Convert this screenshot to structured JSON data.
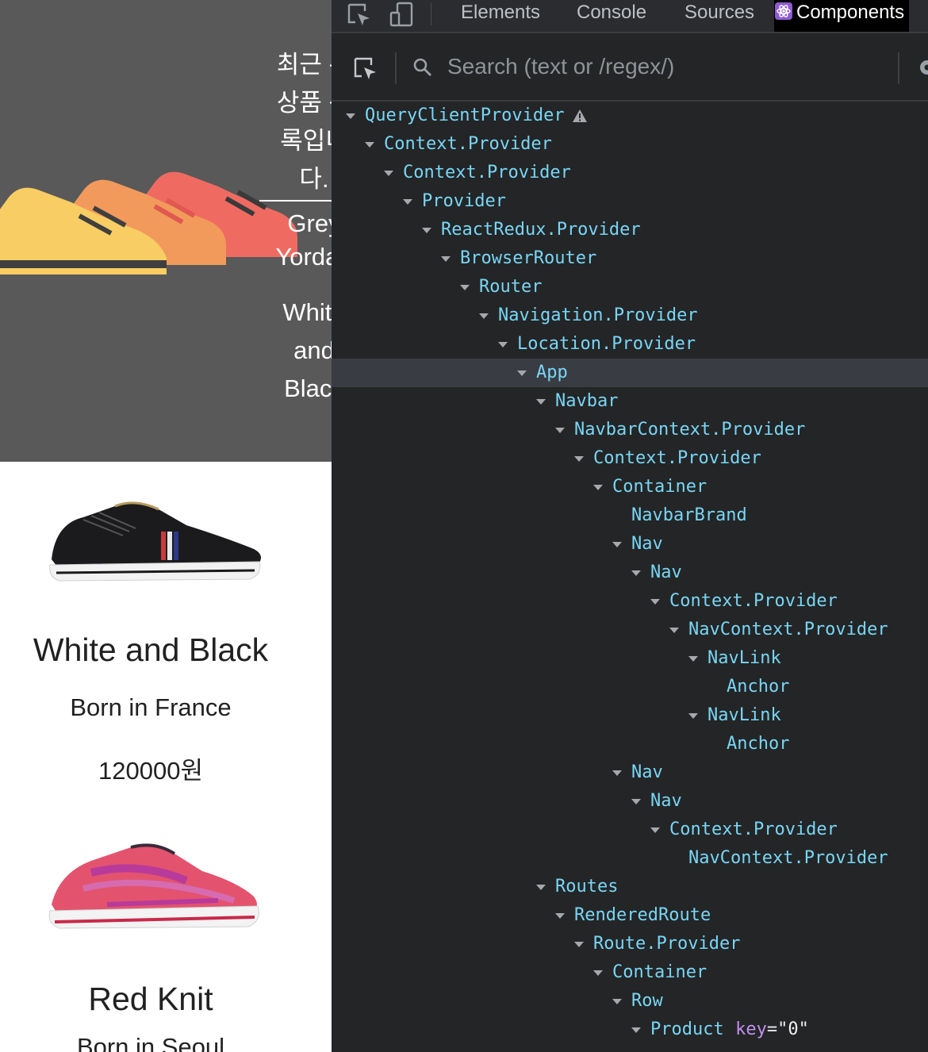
{
  "page": {
    "recent": {
      "heading_lines": [
        "최근 본",
        "상품 목",
        "록입니",
        "다."
      ],
      "items": [
        {
          "lines": [
            "Grey",
            "Yordan"
          ]
        },
        {
          "lines": [
            "White",
            "and",
            "Black"
          ]
        }
      ]
    },
    "products": [
      {
        "name": "White and Black",
        "origin": "Born in France",
        "price": "120000원"
      },
      {
        "name": "Red Knit",
        "origin": "Born in Seoul",
        "price": ""
      }
    ]
  },
  "devtools": {
    "tabs": [
      "Elements",
      "Console",
      "Sources",
      "Components"
    ],
    "active_tab": "Components",
    "search": {
      "placeholder": "Search (text or /regex/)"
    },
    "tree": [
      {
        "label": "QueryClientProvider",
        "expanded": true,
        "warning": true
      },
      {
        "label": "Context.Provider",
        "expanded": true
      },
      {
        "label": "Context.Provider",
        "expanded": true
      },
      {
        "label": "Provider",
        "expanded": true
      },
      {
        "label": "ReactRedux.Provider",
        "expanded": true
      },
      {
        "label": "BrowserRouter",
        "expanded": true
      },
      {
        "label": "Router",
        "expanded": true
      },
      {
        "label": "Navigation.Provider",
        "expanded": true
      },
      {
        "label": "Location.Provider",
        "expanded": true
      },
      {
        "label": "App",
        "expanded": true,
        "selected": true
      },
      {
        "label": "Navbar",
        "expanded": true
      },
      {
        "label": "NavbarContext.Provider",
        "expanded": true
      },
      {
        "label": "Context.Provider",
        "expanded": true
      },
      {
        "label": "Container",
        "expanded": true
      },
      {
        "label": "NavbarBrand",
        "expanded": false
      },
      {
        "label": "Nav",
        "expanded": true
      },
      {
        "label": "Nav",
        "expanded": true
      },
      {
        "label": "Context.Provider",
        "expanded": true
      },
      {
        "label": "NavContext.Provider",
        "expanded": true
      },
      {
        "label": "NavLink",
        "expanded": true
      },
      {
        "label": "Anchor",
        "expanded": false
      },
      {
        "label": "NavLink",
        "expanded": true
      },
      {
        "label": "Anchor",
        "expanded": false
      },
      {
        "label": "Nav",
        "expanded": true
      },
      {
        "label": "Nav",
        "expanded": true
      },
      {
        "label": "Context.Provider",
        "expanded": true
      },
      {
        "label": "NavContext.Provider",
        "expanded": false
      },
      {
        "label": "Routes",
        "expanded": true
      },
      {
        "label": "RenderedRoute",
        "expanded": true
      },
      {
        "label": "Route.Provider",
        "expanded": true
      },
      {
        "label": "Container",
        "expanded": true
      },
      {
        "label": "Row",
        "expanded": true
      },
      {
        "label": "Product",
        "expanded": true,
        "prop_key": "key",
        "prop_value": "\"0\""
      }
    ],
    "colors": {
      "component": "#78d6f6",
      "prop_key": "#c28ff0",
      "background": "#242526",
      "selected_row": "#3a3c43"
    }
  }
}
